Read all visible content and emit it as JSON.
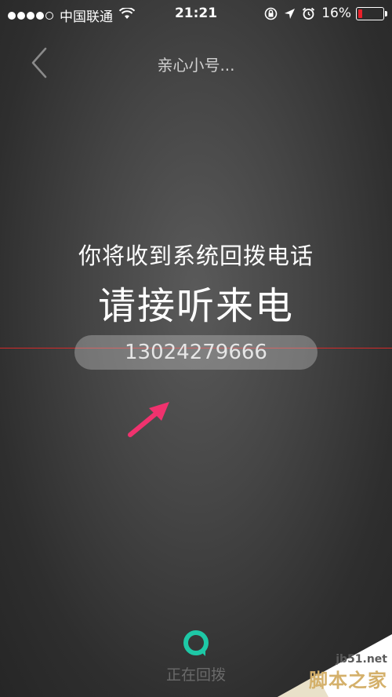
{
  "status_bar": {
    "carrier": "中国联通",
    "time": "21:21",
    "battery_percent": "16%",
    "battery_level": 0.16,
    "battery_color": "#e8202a",
    "signal_dots": 4,
    "icons": [
      "wifi-icon",
      "orientation-lock-icon",
      "location-arrow-icon",
      "alarm-icon",
      "battery-icon"
    ]
  },
  "nav": {
    "back_icon": "chevron-left-icon",
    "title": "亲心小号..."
  },
  "main": {
    "headline": "你将收到系统回拨电话",
    "instruction": "请接听来电",
    "phone_number": "13024279666"
  },
  "annotation": {
    "arrow_color": "#f0326e",
    "line_color": "#d42a2a"
  },
  "footer": {
    "icon": "app-logo-icon",
    "icon_color": "#1ec8a6",
    "status": "正在回拨"
  },
  "watermark": {
    "url": "jb51.net",
    "name": "脚本之家"
  }
}
